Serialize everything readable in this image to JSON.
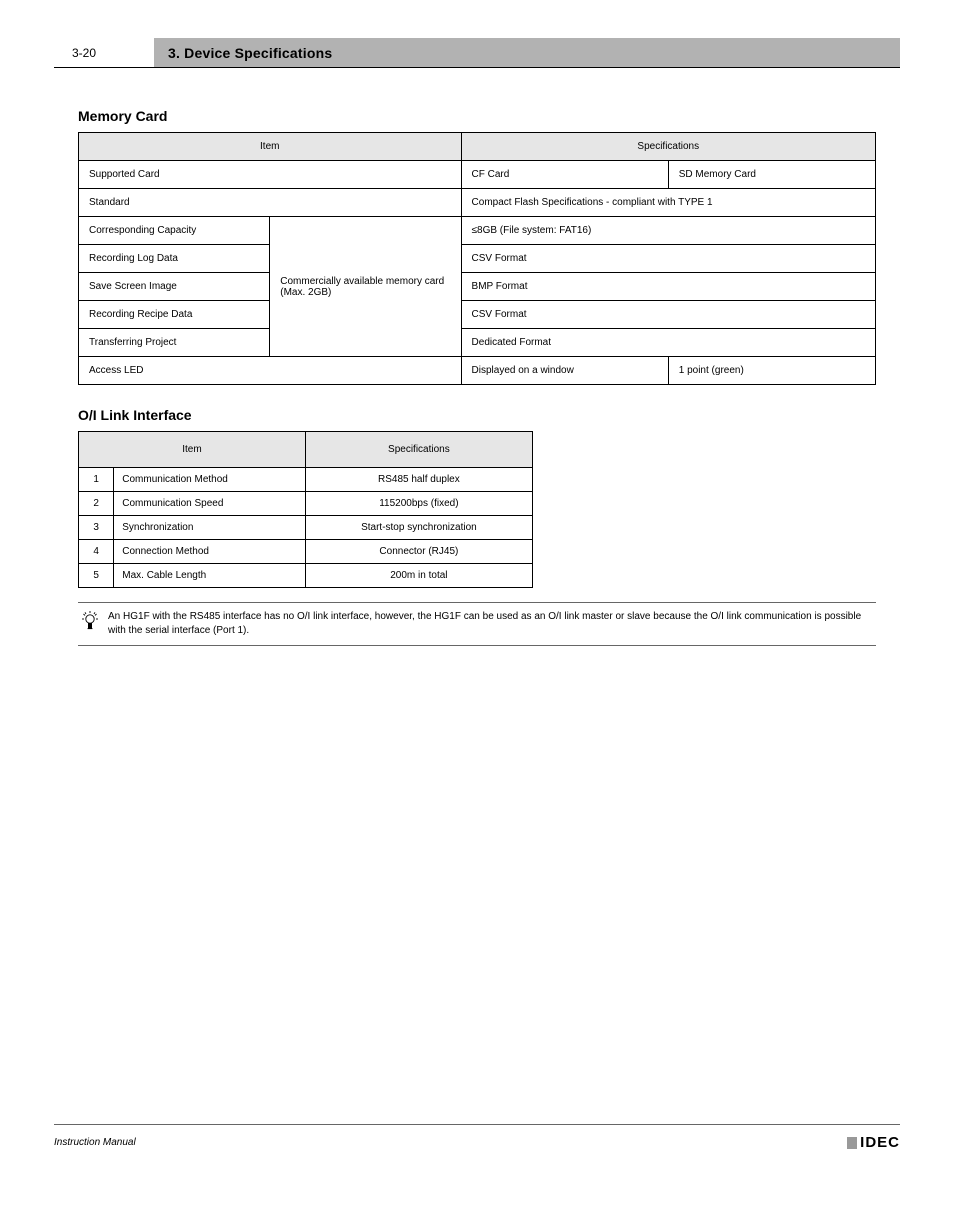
{
  "header": {
    "page_number": "3-20",
    "chapter_title": "3. Device Specifications"
  },
  "section1": {
    "title": "Memory Card",
    "header_row": {
      "label": "Item",
      "value": "Specifications"
    },
    "rows": [
      {
        "label": "Supported Card",
        "value1": "CF Card",
        "value2": "SD Memory Card",
        "split": true
      },
      {
        "label": "Standard",
        "value": "Compact Flash Specifications - compliant with TYPE 1",
        "split": false
      },
      {
        "label": "Corresponding Capacity",
        "groupValue": "Commercially available memory card (Max. 2GB)",
        "value": "≤8GB (File system: FAT16)"
      },
      {
        "label": "Recording Log Data",
        "value": "CSV Format"
      },
      {
        "label": "Save Screen Image",
        "value": "BMP Format"
      },
      {
        "label": "Recording Recipe Data",
        "value": "CSV Format"
      },
      {
        "label": "Transferring Project",
        "value": "Dedicated Format"
      },
      {
        "label": "Access LED",
        "value1": "Displayed on a window",
        "value2": "1 point (green)",
        "split": true
      }
    ]
  },
  "section2": {
    "title": "O/I Link Interface",
    "header_row": {
      "label": "Item",
      "value": "Specifications"
    },
    "rows": [
      {
        "idx": "1",
        "label": "Communication Method",
        "value": "RS485 half duplex"
      },
      {
        "idx": "2",
        "label": "Communication Speed",
        "value": "115200bps (fixed)"
      },
      {
        "idx": "3",
        "label": "Synchronization",
        "value": "Start-stop synchronization"
      },
      {
        "idx": "4",
        "label": "Connection Method",
        "value": "Connector (RJ45)"
      },
      {
        "idx": "5",
        "label": "Max. Cable Length",
        "value": "200m in total"
      }
    ],
    "note": "An HG1F with the RS485 interface has no O/I link interface, however, the HG1F can be used as an O/I link master or slave because the O/I link communication is possible with the serial interface (Port 1)."
  },
  "footer": {
    "left": "Instruction Manual",
    "logo": "IDEC"
  }
}
